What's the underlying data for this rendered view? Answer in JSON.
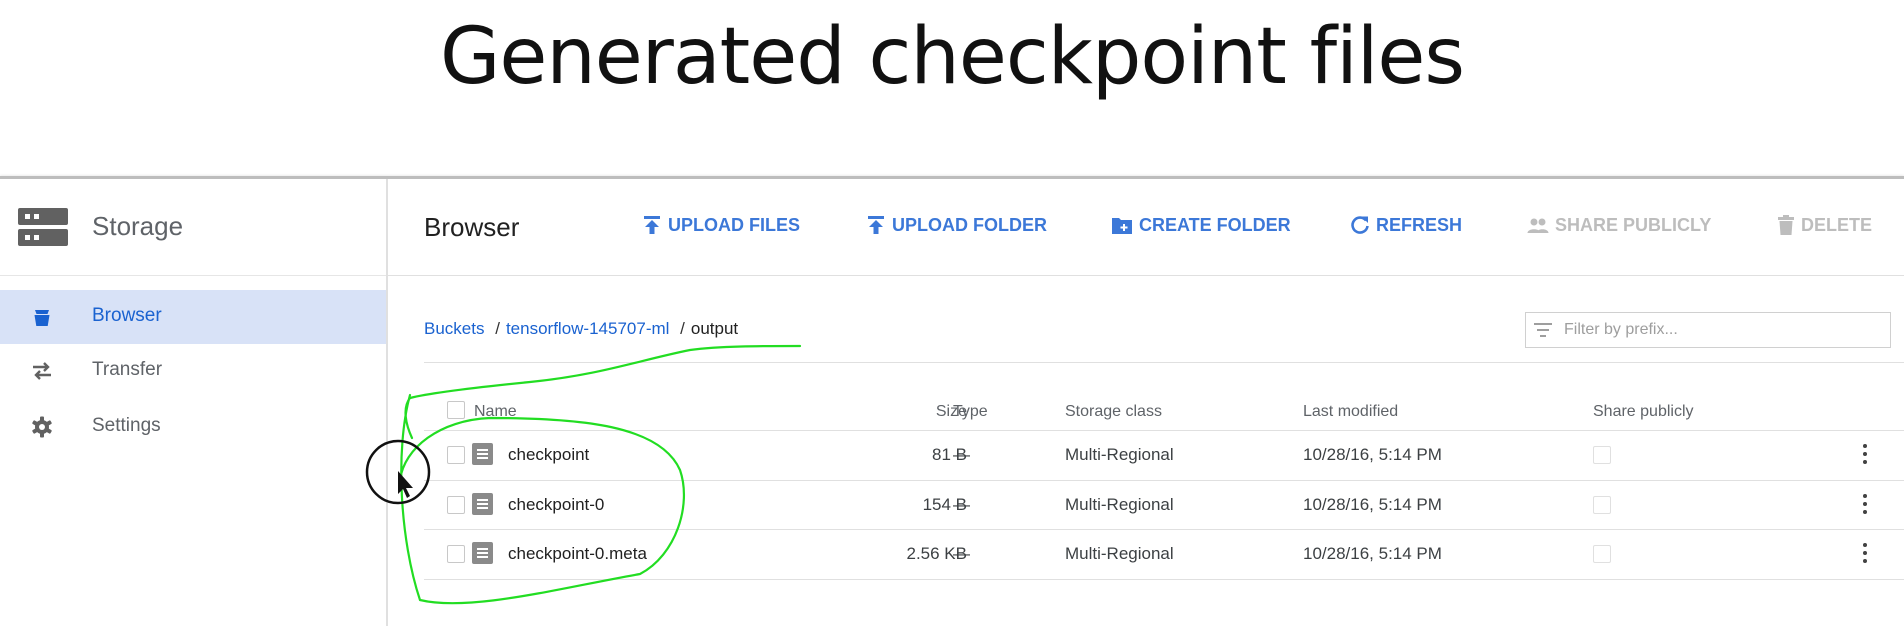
{
  "slide": {
    "title": "Generated checkpoint files"
  },
  "sidebar": {
    "title": "Storage",
    "items": [
      {
        "label": "Browser",
        "icon": "bucket-icon",
        "active": true
      },
      {
        "label": "Transfer",
        "icon": "transfer-arrows-icon",
        "active": false
      },
      {
        "label": "Settings",
        "icon": "gear-icon",
        "active": false
      }
    ]
  },
  "toolbar": {
    "title": "Browser",
    "actions": [
      {
        "label": "UPLOAD FILES",
        "icon": "upload-icon",
        "enabled": true
      },
      {
        "label": "UPLOAD FOLDER",
        "icon": "upload-icon",
        "enabled": true
      },
      {
        "label": "CREATE FOLDER",
        "icon": "create-folder-icon",
        "enabled": true
      },
      {
        "label": "REFRESH",
        "icon": "refresh-icon",
        "enabled": true
      },
      {
        "label": "SHARE PUBLICLY",
        "icon": "people-icon",
        "enabled": false
      },
      {
        "label": "DELETE",
        "icon": "trash-icon",
        "enabled": false
      }
    ]
  },
  "breadcrumb": {
    "root": "Buckets",
    "bucket": "tensorflow-145707-ml",
    "folder": "output",
    "separator": "/"
  },
  "filter": {
    "placeholder": "Filter by prefix...",
    "value": ""
  },
  "table": {
    "columns": [
      "Name",
      "Size",
      "Type",
      "Storage class",
      "Last modified",
      "Share publicly"
    ],
    "rows": [
      {
        "name": "checkpoint",
        "size": "81 B",
        "type": "—",
        "storage_class": "Multi-Regional",
        "last_modified": "10/28/16, 5:14 PM"
      },
      {
        "name": "checkpoint-0",
        "size": "154 B",
        "type": "—",
        "storage_class": "Multi-Regional",
        "last_modified": "10/28/16, 5:14 PM"
      },
      {
        "name": "checkpoint-0.meta",
        "size": "2.56 KB",
        "type": "—",
        "storage_class": "Multi-Regional",
        "last_modified": "10/28/16, 5:14 PM"
      }
    ]
  },
  "colors": {
    "accent": "#3c78d8",
    "active_nav_bg": "#d8e2f7",
    "annotation": "#22dd22",
    "disabled": "#bdbdbd"
  }
}
